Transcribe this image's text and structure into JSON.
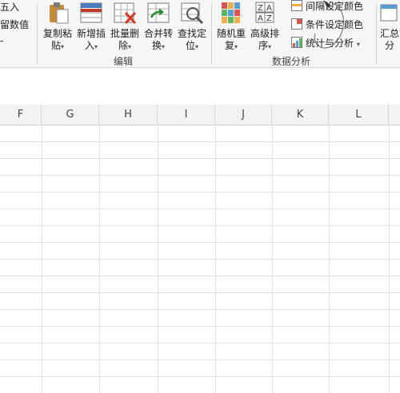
{
  "ribbon": {
    "left_partial": [
      "五入",
      "留数值",
      "-"
    ],
    "edit_buttons": [
      {
        "line1": "复制粘",
        "line2": "贴",
        "icon": "clipboard-icon"
      },
      {
        "line1": "新增插",
        "line2": "入",
        "icon": "insert-rows-icon"
      },
      {
        "line1": "批量删",
        "line2": "除",
        "icon": "batch-delete-icon"
      },
      {
        "line1": "合并转",
        "line2": "换",
        "icon": "merge-convert-icon"
      },
      {
        "line1": "查找定",
        "line2": "位",
        "icon": "find-locate-icon"
      }
    ],
    "edit_group_label": "编辑",
    "analysis_buttons": [
      {
        "line1": "随机重",
        "line2": "复",
        "icon": "random-repeat-icon"
      },
      {
        "line1": "高级排",
        "line2": "序",
        "icon": "advanced-sort-icon"
      }
    ],
    "analysis_small": [
      {
        "label": "间隔设定颜色",
        "icon": "interval-color-icon"
      },
      {
        "label": "条件设定颜色",
        "icon": "conditional-color-icon"
      },
      {
        "label": "统计与分析",
        "icon": "statistics-icon"
      }
    ],
    "analysis_group_label": "数据分析",
    "right_partial": {
      "line1": "汇总",
      "line2": "分"
    },
    "caret": "▾"
  },
  "columns": [
    "F",
    "G",
    "H",
    "I",
    "J",
    "K",
    "L"
  ]
}
